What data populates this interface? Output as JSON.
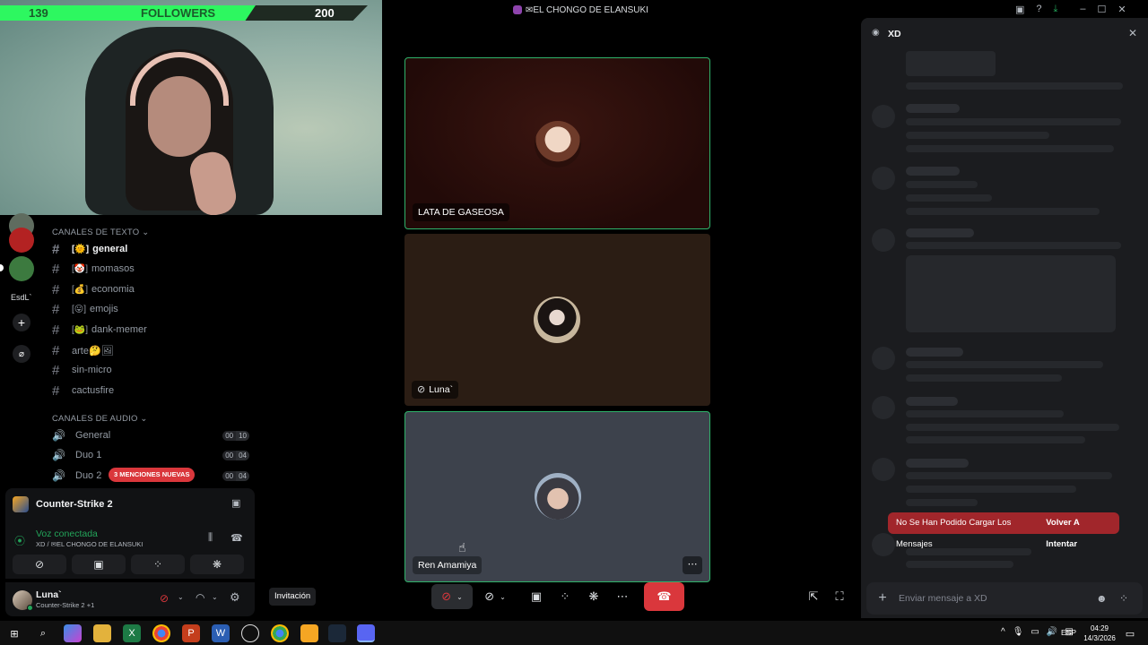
{
  "window": {
    "title": "✉EL CHONGO DE ELANSUKI"
  },
  "stream_overlay": {
    "followers_current": "139",
    "followers_label": "FOLLOWERS",
    "followers_goal": "200",
    "progress_fraction": 0.695,
    "bar_color": "#2df760"
  },
  "server_rail": {
    "items": [
      {
        "label": "",
        "color": "#5f6c5f"
      },
      {
        "label": "",
        "color": "#b32222"
      },
      {
        "label": "",
        "color": "#3c7a3f"
      },
      {
        "label": "EsdL`",
        "color": ""
      }
    ],
    "add_icon": "plus-icon",
    "discover_icon": "compass-icon"
  },
  "channels": {
    "text_category": "CANALES DE TEXTO ⌄",
    "text_channels": [
      {
        "prefix": "[🌞]",
        "name": "general",
        "active": true
      },
      {
        "prefix": "[🤡]",
        "name": "momasos",
        "active": false
      },
      {
        "prefix": "[💰]",
        "name": "economia",
        "active": false
      },
      {
        "prefix": "[😛]",
        "name": "emojis",
        "active": false
      },
      {
        "prefix": "[🐸]",
        "name": "dank-memer",
        "active": false
      },
      {
        "prefix": "",
        "name": "arte🤔🖼",
        "active": false
      },
      {
        "prefix": "",
        "name": "sin-micro",
        "active": false
      },
      {
        "prefix": "",
        "name": "cactusfire",
        "active": false
      }
    ],
    "voice_category": "CANALES DE AUDIO ⌄",
    "voice_channels": [
      {
        "name": "General",
        "count_a": "00",
        "count_b": "10"
      },
      {
        "name": "Duo 1",
        "count_a": "00",
        "count_b": "04"
      },
      {
        "name": "Duo 2",
        "count_a": "00",
        "count_b": "04"
      }
    ],
    "mentions_badge": "3 MENCIONES NUEVAS"
  },
  "activity": {
    "game": "Counter-Strike 2"
  },
  "voice_status": {
    "status": "Voz conectada",
    "location": "XD / ✉EL CHONGO DE ELANSUKI"
  },
  "user": {
    "name": "Luna`",
    "status": "Counter-Strike 2 +1"
  },
  "call": {
    "participants": [
      {
        "name": "LATA DE GASEOSA",
        "muted": false
      },
      {
        "name": "Luna`",
        "muted": true
      },
      {
        "name": "Ren Amamiya",
        "muted": false
      }
    ],
    "invite_label": "Invitación"
  },
  "chat_panel": {
    "channel": "XD",
    "error_text": "No Se Han Podido Cargar Los Mensajes",
    "retry_label": "Volver A Intentar",
    "input_placeholder": "Enviar mensaje a XD"
  },
  "taskbar": {
    "language": "ESP",
    "time": "04:29",
    "date": "14/3/2026"
  }
}
